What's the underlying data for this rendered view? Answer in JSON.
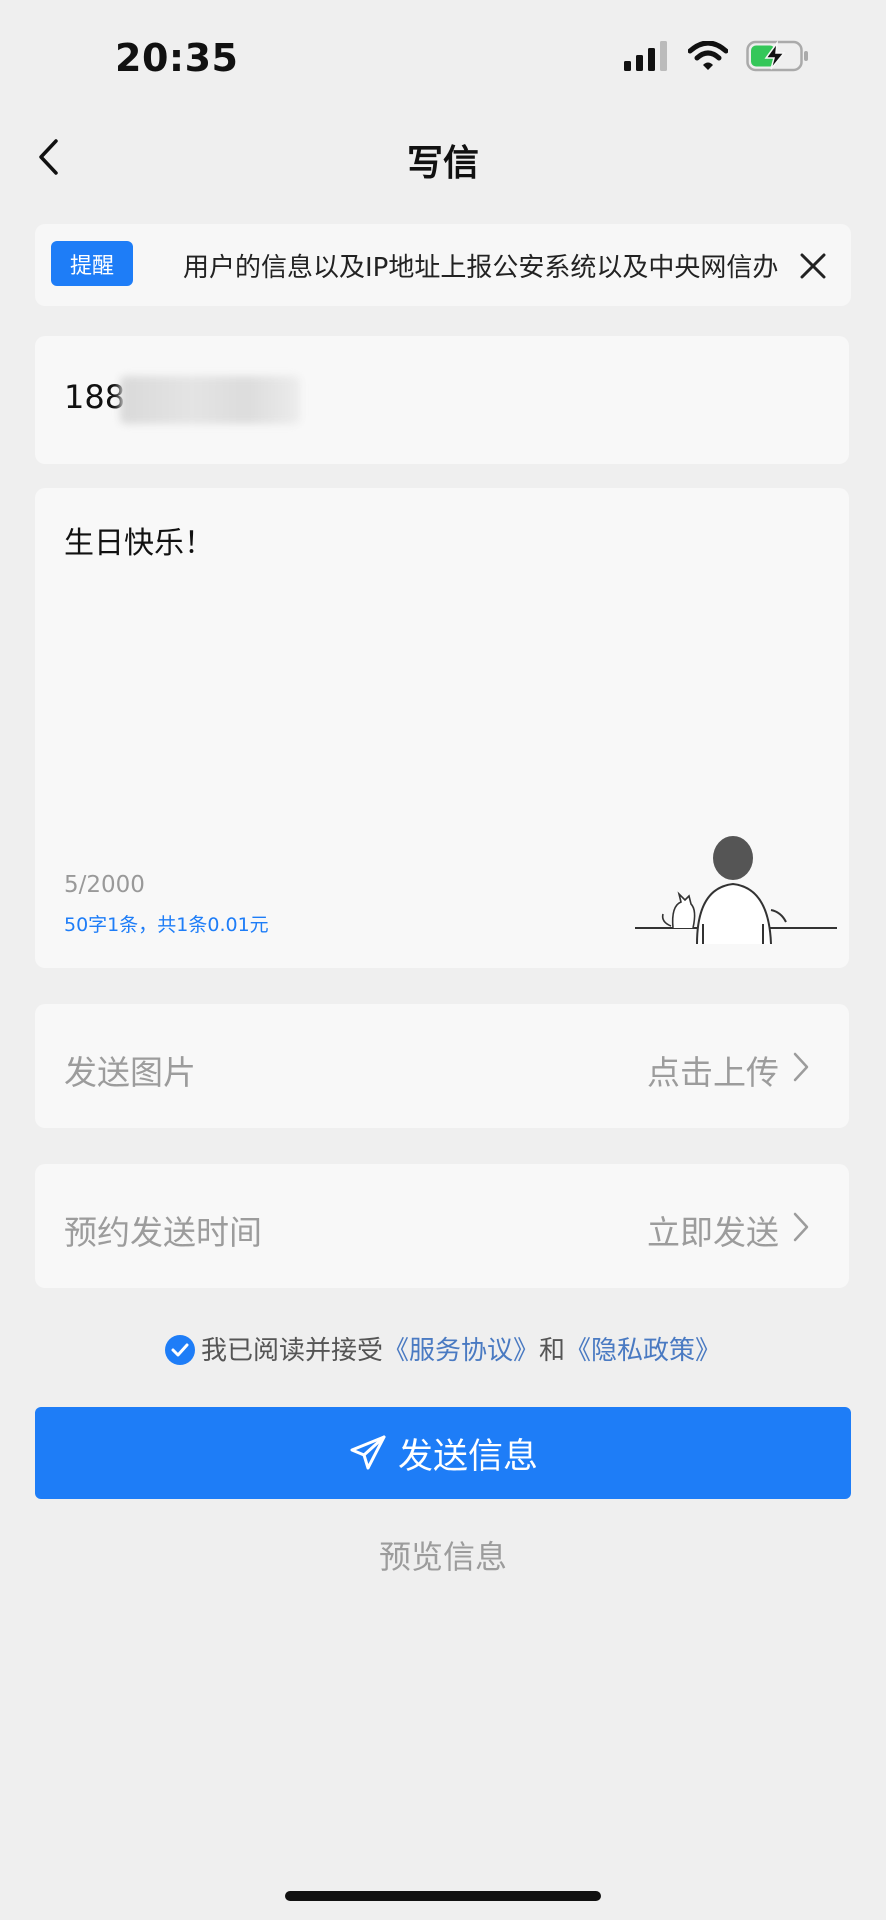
{
  "status_bar": {
    "time": "20:35"
  },
  "nav": {
    "title": "写信"
  },
  "notice": {
    "badge": "提醒",
    "text": "用户的信息以及IP地址上报公安系统以及中央网信办"
  },
  "recipient": {
    "visible_prefix": "188"
  },
  "message": {
    "text": "生日快乐！",
    "char_count": "5/2000",
    "pricing": "50字1条，共1条0.01元"
  },
  "send_image": {
    "label": "发送图片",
    "value": "点击上传"
  },
  "schedule": {
    "label": "预约发送时间",
    "value": "立即发送"
  },
  "agreement": {
    "prefix": "我已阅读并接受",
    "service_link": "《服务协议》",
    "and": "和",
    "privacy_link": "《隐私政策》",
    "checked": true
  },
  "buttons": {
    "send": "发送信息",
    "preview": "预览信息"
  },
  "colors": {
    "accent": "#1e7df7",
    "background": "#efefef",
    "card": "#f8f8f8",
    "link": "#4a7ac2"
  }
}
